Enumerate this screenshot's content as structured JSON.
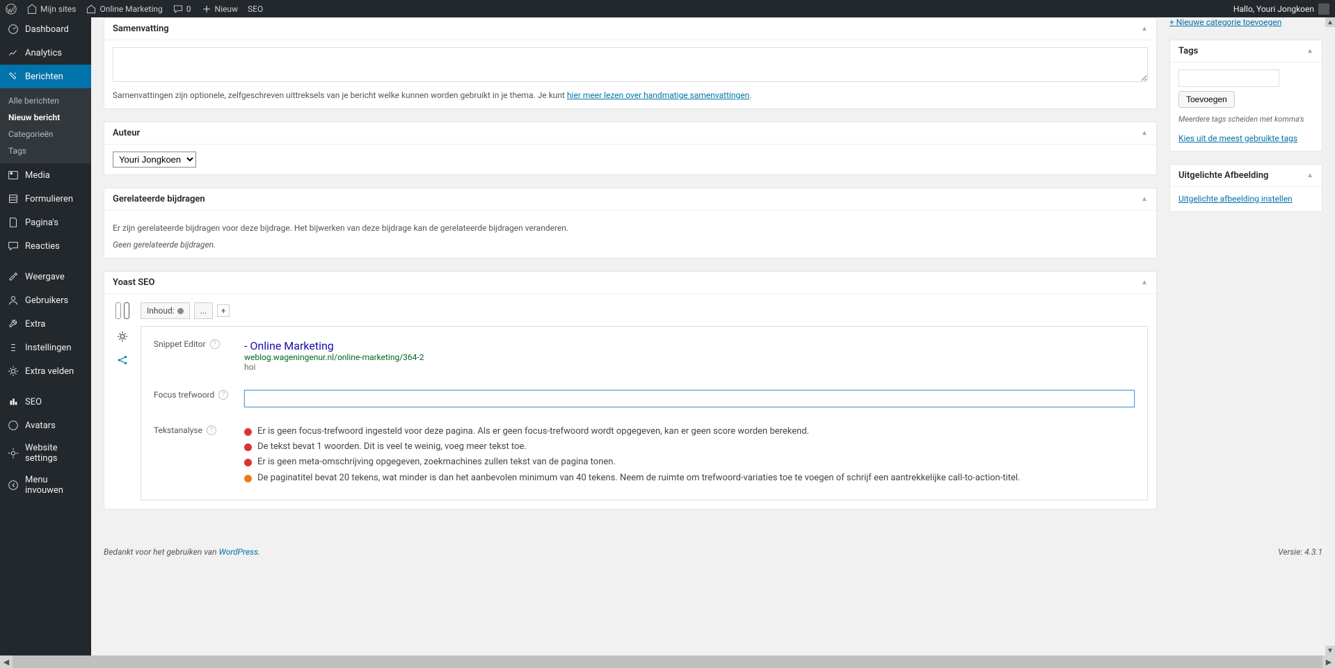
{
  "topbar": {
    "mysites": "Mijn sites",
    "sitename": "Online Marketing",
    "comments": "0",
    "new": "Nieuw",
    "seo": "SEO",
    "greeting": "Hallo, Youri Jongkoen"
  },
  "sidebar": {
    "dashboard": "Dashboard",
    "analytics": "Analytics",
    "posts": "Berichten",
    "posts_sub": {
      "all": "Alle berichten",
      "new": "Nieuw bericht",
      "cats": "Categorieën",
      "tags": "Tags"
    },
    "media": "Media",
    "forms": "Formulieren",
    "pages": "Pagina's",
    "comments": "Reacties",
    "appearance": "Weergave",
    "users": "Gebruikers",
    "tools": "Extra",
    "settings": "Instellingen",
    "extra_fields": "Extra velden",
    "seo": "SEO",
    "avatars": "Avatars",
    "website_settings": "Website settings",
    "collapse": "Menu invouwen"
  },
  "summary": {
    "title": "Samenvatting",
    "help_pre": "Samenvattingen zijn optionele, zelfgeschreven uittreksels van je bericht welke kunnen worden gebruikt in je thema. Je kunt ",
    "help_link": "hier meer lezen over handmatige samenvattingen",
    "help_post": "."
  },
  "author": {
    "title": "Auteur",
    "selected": "Youri Jongkoen"
  },
  "related": {
    "title": "Gerelateerde bijdragen",
    "line1": "Er zijn gerelateerde bijdragen voor deze bijdrage. Het bijwerken van deze bijdrage kan de gerelateerde bijdragen veranderen.",
    "line2": "Geen gerelateerde bijdragen."
  },
  "yoast": {
    "title": "Yoast SEO",
    "tab_content": "Inhoud:",
    "tab_more": "...",
    "tab_add": "+",
    "snippet_label": "Snippet Editor",
    "snippet_title": "- Online Marketing",
    "snippet_url": "weblog.wageningenur.nl/online-marketing/364-2",
    "snippet_desc": "hoi",
    "focus_label": "Focus trefwoord",
    "focus_value": "",
    "analysis_label": "Tekstanalyse",
    "analysis": [
      {
        "color": "red",
        "text": "Er is geen focus-trefwoord ingesteld voor deze pagina. Als er geen focus-trefwoord wordt opgegeven, kan er geen score worden berekend."
      },
      {
        "color": "red",
        "text": "De tekst bevat 1 woorden. Dit is veel te weinig, voeg meer tekst toe."
      },
      {
        "color": "red",
        "text": "Er is geen meta-omschrijving opgegeven, zoekmachines zullen tekst van de pagina tonen."
      },
      {
        "color": "orange",
        "text": "De paginatitel bevat 20 tekens, wat minder is dan het aanbevolen minimum van 40 tekens. Neem de ruimte om trefwoord-variaties toe te voegen of schrijf een aantrekkelijke call-to-action-titel."
      }
    ]
  },
  "side": {
    "new_category": "+ Nieuwe categorie toevoegen",
    "tags_title": "Tags",
    "tags_add": "Toevoegen",
    "tags_help": "Meerdere tags scheiden met komma's",
    "tags_popular": "Kies uit de meest gebruikte tags",
    "featured_title": "Uitgelichte Afbeelding",
    "featured_link": "Uitgelichte afbeelding instellen"
  },
  "footer": {
    "thanks_pre": "Bedankt voor het gebruiken van ",
    "thanks_link": "WordPress",
    "version": "Versie: 4.3.1"
  }
}
